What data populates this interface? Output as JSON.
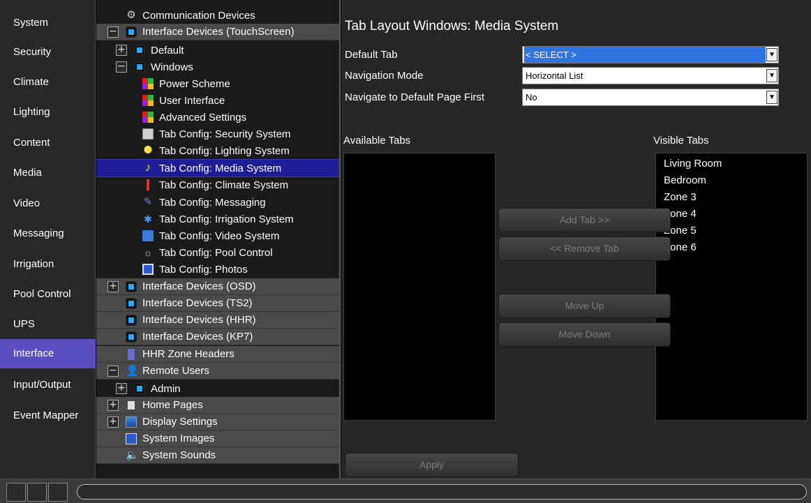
{
  "left_nav": {
    "items": [
      {
        "label": "System"
      },
      {
        "label": "Security"
      },
      {
        "label": "Climate"
      },
      {
        "label": "Lighting"
      },
      {
        "label": "Content"
      },
      {
        "label": "Media"
      },
      {
        "label": "Video"
      },
      {
        "label": "Messaging"
      },
      {
        "label": "Irrigation"
      },
      {
        "label": "Pool Control"
      },
      {
        "label": "UPS"
      },
      {
        "label": "Interface"
      },
      {
        "label": "Input/Output"
      },
      {
        "label": "Event Mapper"
      }
    ],
    "active": "Interface"
  },
  "tree": {
    "items": [
      {
        "label": "Communication Devices",
        "icon": "network-icon"
      },
      {
        "label": "Interface Devices (TouchScreen)",
        "icon": "touchscreen-icon",
        "expander": "minus"
      },
      {
        "label": "Default",
        "icon": "touchscreen-icon",
        "expander": "plus"
      },
      {
        "label": "Windows",
        "icon": "touchscreen-icon",
        "expander": "minus"
      },
      {
        "label": "Power Scheme",
        "icon": "grid-icon"
      },
      {
        "label": "User Interface",
        "icon": "grid-icon"
      },
      {
        "label": "Advanced Settings",
        "icon": "grid-icon"
      },
      {
        "label": "Tab Config: Security System",
        "icon": "security-tab-icon"
      },
      {
        "label": "Tab Config: Lighting System",
        "icon": "bulb-icon"
      },
      {
        "label": "Tab Config: Media System",
        "icon": "music-note-icon",
        "selected": true
      },
      {
        "label": "Tab Config: Climate System",
        "icon": "thermometer-icon"
      },
      {
        "label": "Tab Config: Messaging",
        "icon": "pen-icon"
      },
      {
        "label": "Tab Config: Irrigation System",
        "icon": "sprinkler-icon"
      },
      {
        "label": "Tab Config: Video System",
        "icon": "video-icon"
      },
      {
        "label": "Tab Config: Pool Control",
        "icon": "pool-icon"
      },
      {
        "label": "Tab Config: Photos",
        "icon": "photo-icon"
      },
      {
        "label": "Interface Devices (OSD)",
        "icon": "touchscreen-icon",
        "expander": "plus"
      },
      {
        "label": "Interface Devices (TS2)",
        "icon": "touchscreen-icon"
      },
      {
        "label": "Interface Devices (HHR)",
        "icon": "touchscreen-icon"
      },
      {
        "label": "Interface Devices (KP7)",
        "icon": "touchscreen-icon"
      },
      {
        "label": "HHR Zone Headers",
        "icon": "header-icon"
      },
      {
        "label": "Remote Users",
        "icon": "users-icon",
        "expander": "minus"
      },
      {
        "label": "Admin",
        "icon": "touchscreen-icon",
        "expander": "plus"
      },
      {
        "label": "Home Pages",
        "icon": "home-page-icon",
        "expander": "plus"
      },
      {
        "label": "Display Settings",
        "icon": "display-icon",
        "expander": "plus"
      },
      {
        "label": "System Images",
        "icon": "image-icon"
      },
      {
        "label": "System Sounds",
        "icon": "speaker-icon"
      }
    ]
  },
  "main": {
    "title": "Tab Layout Windows: Media System",
    "fields": [
      {
        "label": "Default Tab",
        "value": "< SELECT >"
      },
      {
        "label": "Navigation Mode",
        "value": "Horizontal List"
      },
      {
        "label": "Navigate to Default Page First",
        "value": "No"
      }
    ],
    "available_label": "Available Tabs",
    "visible_label": "Visible Tabs",
    "available_tabs": [],
    "visible_tabs": [
      "Living Room",
      "Bedroom",
      "Zone 3",
      "Zone 4",
      "Zone 5",
      "Zone 6"
    ],
    "buttons": {
      "add": "Add Tab >>",
      "remove": "<< Remove Tab",
      "up": "Move Up",
      "down": "Move Down",
      "apply": "Apply"
    }
  },
  "colors": {
    "nav_active": "#5a4ec0",
    "tree_selected": "#1f1c95",
    "select_highlight": "#2f74e0"
  }
}
